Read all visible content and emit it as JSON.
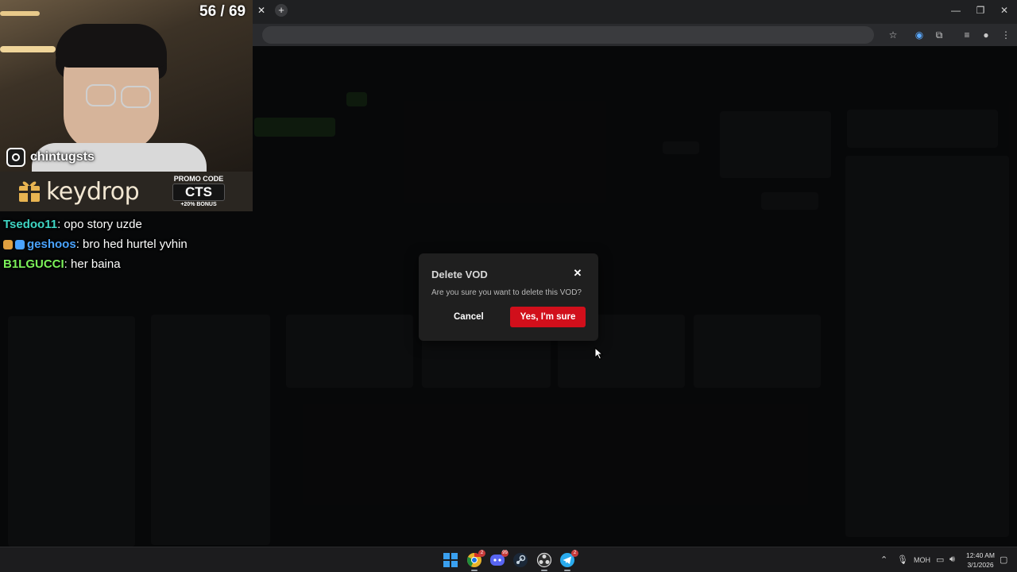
{
  "stream_overlay": {
    "counter": "56 / 69",
    "instagram_handle": "chintugsts",
    "sponsor_logo": "keydrop",
    "promo": {
      "label": "PROMO CODE",
      "code": "CTS",
      "bonus": "+20% BONUS"
    },
    "chat": [
      {
        "user": "Tsedoo11",
        "message": ": opo story uzde",
        "color": "#3fd6c4"
      },
      {
        "user": "geshoos",
        "message": ": bro hed hurtel yvhin",
        "color": "#4aa3ff"
      },
      {
        "user": "B1LGUCCI",
        "message": ": her baina",
        "color": "#7cf25a"
      }
    ]
  },
  "browser": {
    "tab_close_icon": "close-icon",
    "new_tab_icon": "plus-icon"
  },
  "modal": {
    "title": "Delete VOD",
    "message": "Are you sure you want to delete this VOD?",
    "cancel_label": "Cancel",
    "confirm_label": "Yes, I'm sure",
    "confirm_color": "#d10f1b"
  },
  "taskbar": {
    "apps": [
      {
        "name": "windows-start-icon",
        "color": "#3aa0f0"
      },
      {
        "name": "chrome-icon",
        "color": "#e8b32a",
        "badge": "2",
        "active": true
      },
      {
        "name": "discord-icon",
        "color": "#5865f2",
        "badge": "99",
        "active": false
      },
      {
        "name": "steam-icon",
        "color": "#1b2838",
        "active": false
      },
      {
        "name": "obs-icon",
        "color": "#3b3b3b",
        "active": true
      },
      {
        "name": "telegram-icon",
        "color": "#2aabee",
        "badge": "2",
        "active": true
      }
    ],
    "language": "МОН",
    "time": "12:40 AM",
    "date": "3/1/2026"
  }
}
